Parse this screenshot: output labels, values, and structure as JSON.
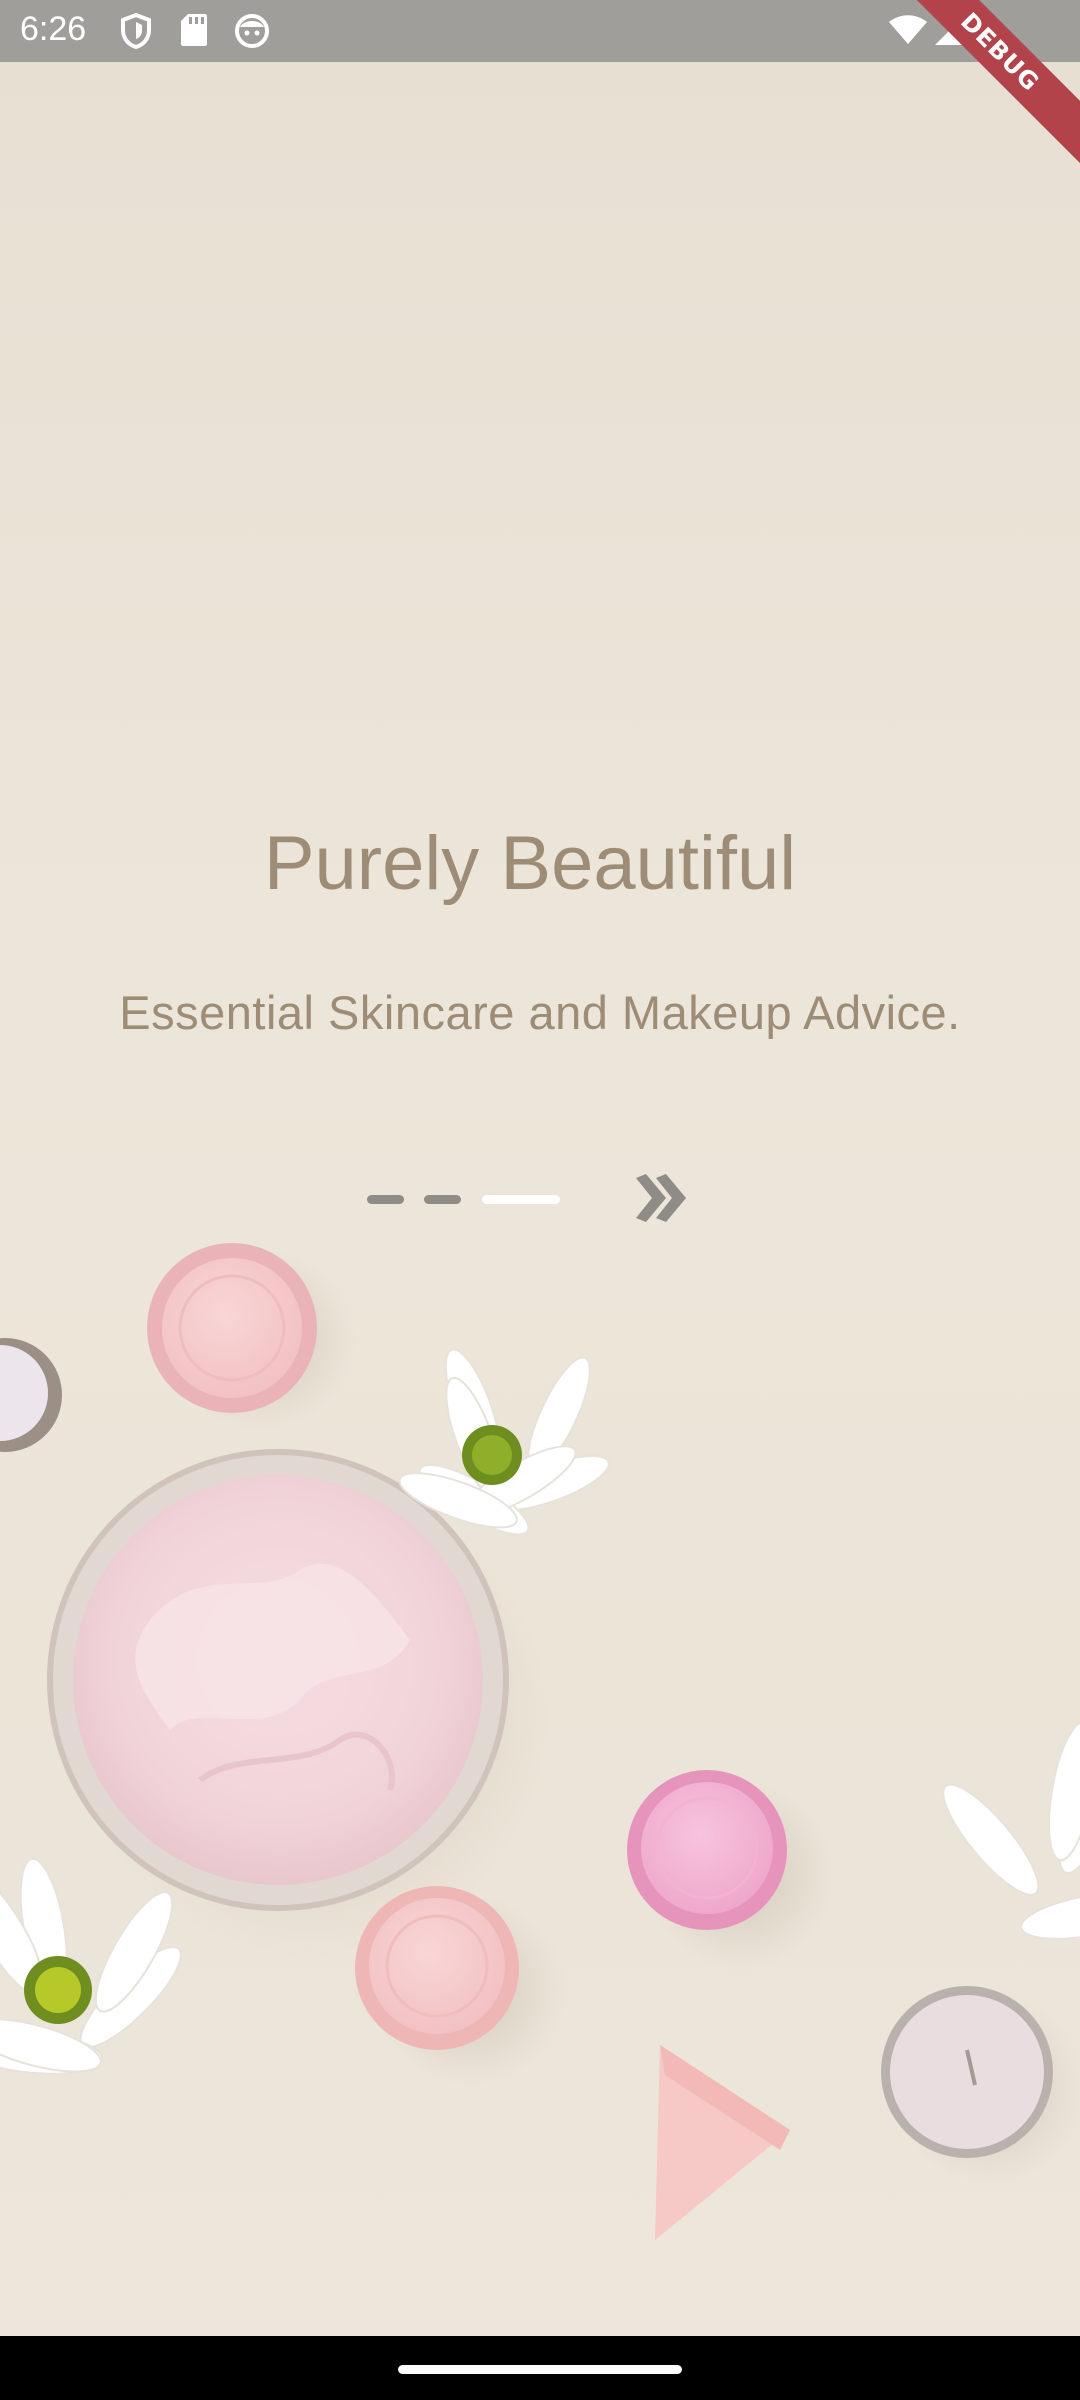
{
  "status_bar": {
    "time": "6:26",
    "left_icons": [
      "shield-icon",
      "sd-card-icon",
      "face-icon"
    ],
    "right_icons": [
      "wifi-icon",
      "cellular-icon"
    ]
  },
  "debug_banner": "DEBUG",
  "onboarding": {
    "title": "Purely Beautiful",
    "subtitle": "Essential Skincare and Makeup Advice.",
    "page_indicator": {
      "total": 3,
      "active_index": 2
    },
    "next_icon": "double-chevron-right-icon"
  },
  "colors": {
    "background": "#ebe4d8",
    "text": "#9e8d76",
    "indicator_inactive": "#8f8b86",
    "indicator_active": "#ffffff"
  }
}
